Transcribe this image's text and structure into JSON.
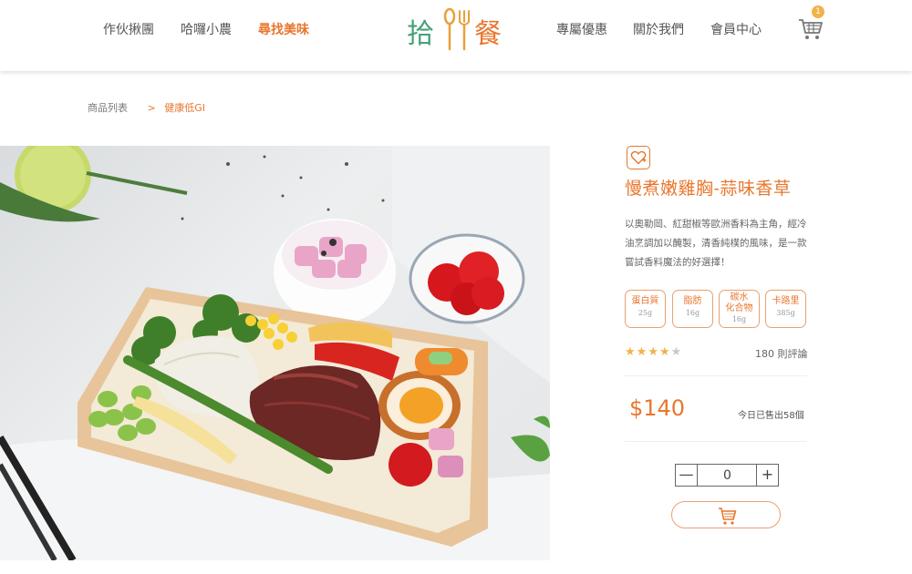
{
  "nav": {
    "left": [
      "作伙揪團",
      "哈囉小農",
      "尋找美味"
    ],
    "right": [
      "專屬優惠",
      "關於我們",
      "會員中心"
    ],
    "active": "尋找美味"
  },
  "logo": {
    "left_char": "拾",
    "right_char": "餐"
  },
  "cart": {
    "count": "1",
    "icon": "cart-icon"
  },
  "breadcrumb": {
    "root": "商品列表",
    "separator": ">",
    "current": "健康低GI"
  },
  "product": {
    "title": "慢煮嫩雞胸-蒜味香草",
    "description": "以奧勒岡、紅甜椒等歐洲香料為主角，經冷油烹調加以醃製，清香純樸的風味，是一款嘗試香料魔法的好選擇！",
    "nutrition": [
      {
        "label": "蛋白質",
        "value": "25g"
      },
      {
        "label": "脂肪",
        "value": "16g"
      },
      {
        "label": "碳水化合物",
        "label_line1": "碳水",
        "label_line2": "化合物",
        "value": "16g"
      },
      {
        "label": "卡路里",
        "value": "385g"
      }
    ],
    "rating": 4,
    "rating_max": 5,
    "reviews": "180 則評論",
    "price": "$140",
    "sold_today": "今日已售出58個",
    "quantity": "0",
    "qty_minus": "—",
    "qty_plus": "+"
  },
  "colors": {
    "accent": "#e8772e",
    "brand_green": "#46a07a",
    "star": "#f0b24a"
  }
}
